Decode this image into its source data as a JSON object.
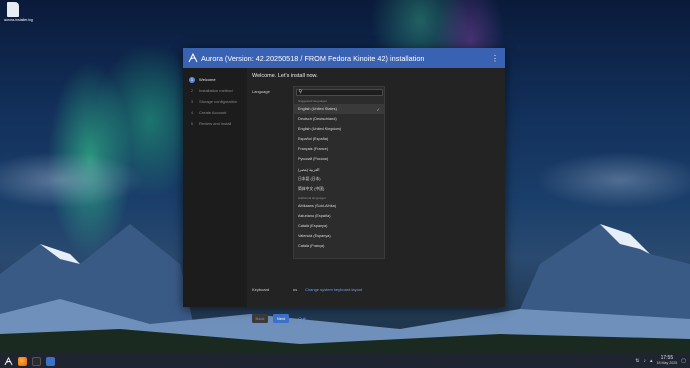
{
  "desktop": {
    "file_label": "aurora-installer.log"
  },
  "window": {
    "title": "Aurora (Version: 42.20250518 / FROM Fedora Kinoite 42) installation",
    "menu_icon": "kebab-menu-icon"
  },
  "sidebar": {
    "steps": [
      {
        "num": "1",
        "label": "Welcome"
      },
      {
        "num": "2",
        "label": "Installation method"
      },
      {
        "num": "3",
        "label": "Storage configuration"
      },
      {
        "num": "4",
        "label": "Create Account"
      },
      {
        "num": "5",
        "label": "Review and install"
      }
    ]
  },
  "main": {
    "heading": "Welcome. Let's install now.",
    "language_label": "Language",
    "search_value": "",
    "suggested_header": "Suggested languages",
    "languages_suggested": [
      "English (United States)",
      "Deutsch (Deutschland)",
      "English (United Kingdom)",
      "Español (España)",
      "Français (France)",
      "Русский (Россия)",
      "العربية (مصر)",
      "日本語 (日本)",
      "简体中文 (中国)"
    ],
    "additional_header": "Additional languages",
    "languages_additional": [
      "Afrikaans (Suid-Afrika)",
      "Asturianu (España)",
      "Català (Espanya)",
      "Valencià (Espanya)",
      "Català (França)"
    ],
    "selected_language": "English (United States)",
    "keyboard_label": "Keyboard",
    "keyboard_value": "us",
    "keyboard_link": "Change system keyboard layout"
  },
  "footer": {
    "back": "Back",
    "next": "Next",
    "quit": "Quit"
  },
  "taskbar": {
    "time": "17:55",
    "date": "18 May 2025"
  },
  "colors": {
    "accent": "#3d71c8",
    "titlebar": "#3a62b2",
    "link": "#6ea0ea"
  }
}
